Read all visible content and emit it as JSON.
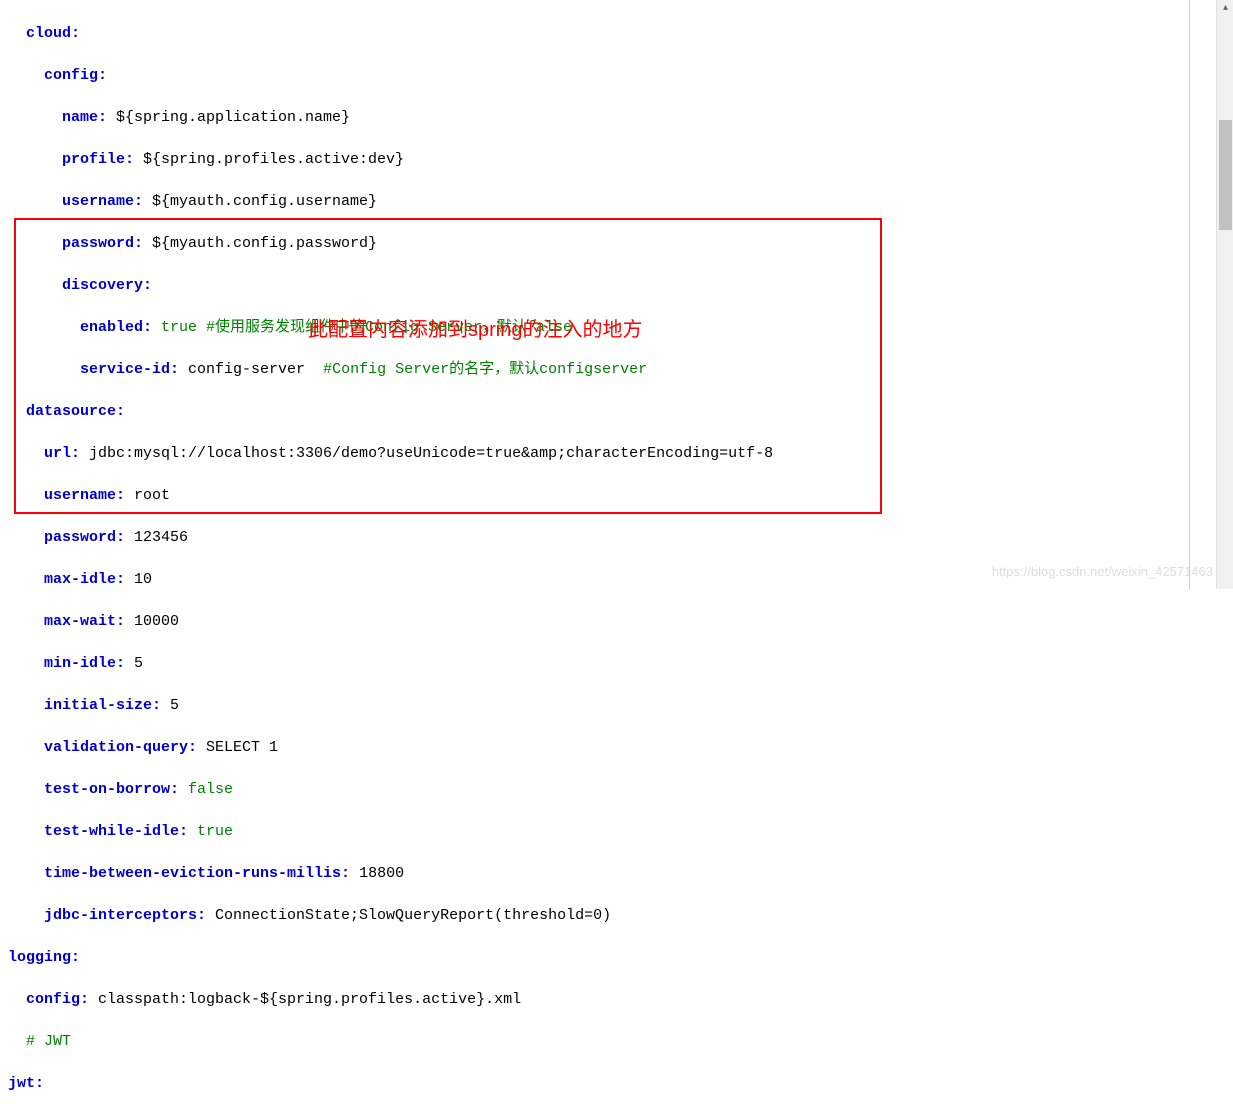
{
  "code": {
    "l1_key": "cloud:",
    "l2_key": "config:",
    "l3_key": "name:",
    "l3_val": " ${spring.application.name}",
    "l4_key": "profile:",
    "l4_val": " ${spring.profiles.active:dev}",
    "l5_key": "username:",
    "l5_val": " ${myauth.config.username}",
    "l6_key": "password:",
    "l6_val": " ${myauth.config.password}",
    "l7_key": "discovery:",
    "l8_key": "enabled:",
    "l8_val": " true",
    "l8_cmt": " #使用服务发现组件中的Config Server，默认false",
    "l9_key": "service-id:",
    "l9_val": " config-server  ",
    "l9_cmt": "#Config Server的名字，默认configserver",
    "l10_key": "datasource:",
    "l11_key": "url:",
    "l11_val": " jdbc:mysql://localhost:3306/demo?useUnicode=true&amp;characterEncoding=utf-8",
    "l12_key": "username:",
    "l12_val": " root",
    "l13_key": "password:",
    "l13_val": " 123456",
    "l14_key": "max-idle:",
    "l14_val": " 10",
    "l15_key": "max-wait:",
    "l15_val": " 10000",
    "l16_key": "min-idle:",
    "l16_val": " 5",
    "l17_key": "initial-size:",
    "l17_val": " 5",
    "l18_key": "validation-query:",
    "l18_val": " SELECT 1",
    "l19_key": "test-on-borrow:",
    "l19_val": " false",
    "l20_key": "test-while-idle:",
    "l20_val": " true",
    "l21_key": "time-between-eviction-runs-millis:",
    "l21_val": " 18800",
    "l22_key": "jdbc-interceptors:",
    "l22_val": " ConnectionState;SlowQueryReport(threshold=0)",
    "l23_key": "logging:",
    "l24_key": "config:",
    "l24_val": " classpath:logback-${spring.profiles.active}.xml",
    "l25_cmt": "# JWT",
    "l26_key": "jwt:"
  },
  "annotation": "此配置内容添加到spring的注入的地方",
  "watermark": "https://blog.csdn.net/weixin_42571463"
}
